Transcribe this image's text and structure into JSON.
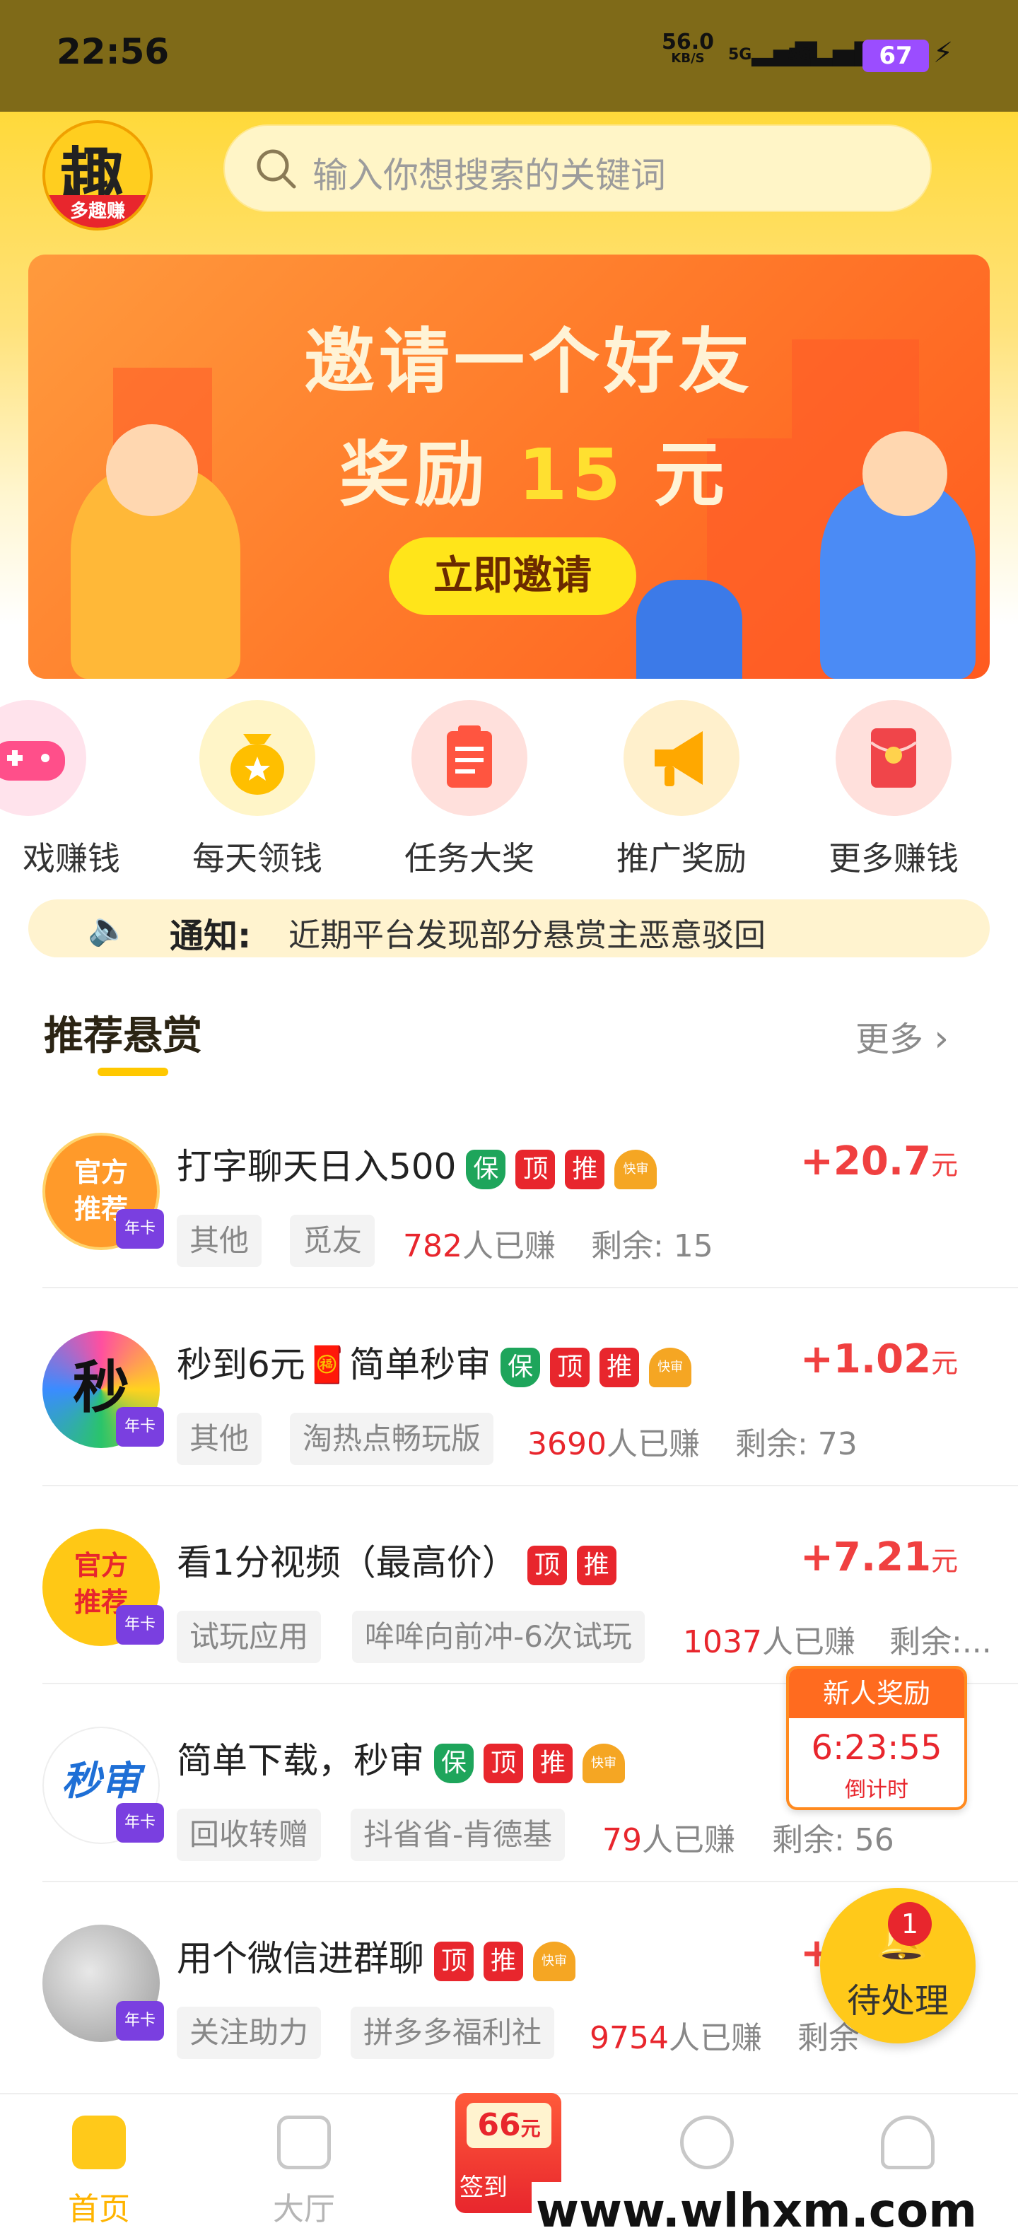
{
  "status_bar": {
    "time": "22:56",
    "net_speed": "56.0",
    "net_unit": "KB/S",
    "sig1": "5G",
    "sig2": "5G",
    "battery": "67"
  },
  "header": {
    "logo_text": "趣",
    "logo_sub": "多趣赚",
    "search_placeholder": "输入你想搜索的关键词"
  },
  "banner": {
    "line1": "邀请一个好友",
    "line2_prefix": "奖励 ",
    "line2_amount": "15",
    "line2_suffix": " 元",
    "cta": "立即邀请"
  },
  "features": [
    {
      "label": "戏赚钱",
      "icon": "gamepad-icon",
      "bg": "#ffe3ec",
      "fg": "#ff4f8a"
    },
    {
      "label": "每天领钱",
      "icon": "money-bag-icon",
      "bg": "#fff5c8",
      "fg": "#ffbf00"
    },
    {
      "label": "任务大奖",
      "icon": "clipboard-icon",
      "bg": "#ffe0dc",
      "fg": "#ff5540"
    },
    {
      "label": "推广奖励",
      "icon": "megaphone-icon",
      "bg": "#fff0cc",
      "fg": "#ffa800"
    },
    {
      "label": "更多赚钱",
      "icon": "red-packet-icon",
      "bg": "#ffe0dc",
      "fg": "#f0454a"
    }
  ],
  "notice": {
    "label": "通知:",
    "text": "近期平台发现部分悬赏主恶意驳回"
  },
  "section": {
    "title": "推荐悬赏",
    "more": "更多"
  },
  "tasks": [
    {
      "title": "打字聊天日入500",
      "avatar_text": "官方推荐",
      "crown": "年卡",
      "badges": [
        "保",
        "顶",
        "推",
        "快审"
      ],
      "price": "+20.7",
      "unit": "元",
      "tags": [
        "其他",
        "觅友"
      ],
      "earned": "782",
      "earned_suffix": "人已赚",
      "remain": "剩余: 15"
    },
    {
      "title": "秒到6元🧧简单秒审",
      "avatar_text": "秒",
      "crown": "年卡",
      "badges": [
        "保",
        "顶",
        "推",
        "快审"
      ],
      "price": "+1.02",
      "unit": "元",
      "tags": [
        "其他",
        "淘热点畅玩版"
      ],
      "earned": "3690",
      "earned_suffix": "人已赚",
      "remain": "剩余: 73"
    },
    {
      "title": "看1分视频（最高价）",
      "avatar_text": "官方推荐",
      "crown": "年卡",
      "badges": [
        "顶",
        "推"
      ],
      "price": "+7.21",
      "unit": "元",
      "tags": [
        "试玩应用",
        "哞哞向前冲-6次试玩"
      ],
      "earned": "1037",
      "earned_suffix": "人已赚",
      "remain": "剩余:..."
    },
    {
      "title": "简单下载，秒审",
      "avatar_text": "秒审",
      "crown": "年卡",
      "badges": [
        "保",
        "顶",
        "推",
        "快审"
      ],
      "price": "",
      "unit": "",
      "tags": [
        "回收转赠",
        "抖省省-肯德基"
      ],
      "earned": "79",
      "earned_suffix": "人已赚",
      "remain": "剩余: 56"
    },
    {
      "title": "用个微信进群聊",
      "avatar_text": "",
      "crown": "年卡",
      "badges": [
        "顶",
        "推",
        "快审"
      ],
      "price": "+",
      "unit": "",
      "tags": [
        "关注助力",
        "拼多多福利社"
      ],
      "earned": "9754",
      "earned_suffix": "人已赚",
      "remain": "剩余"
    }
  ],
  "newbie": {
    "title": "新人奖励",
    "time": "6:23:55",
    "label": "倒计时"
  },
  "pending": {
    "count": "1",
    "label": "待处理"
  },
  "bottom_nav": [
    {
      "label": "首页",
      "icon": "home-icon",
      "active": true
    },
    {
      "label": "大厅",
      "icon": "chart-icon",
      "active": false
    },
    {
      "label": "签到",
      "icon": "sign-in-icon",
      "amount": "66",
      "unit": "元"
    },
    {
      "label": "",
      "icon": "compass-icon",
      "active": false
    },
    {
      "label": "",
      "icon": "user-icon",
      "active": false
    }
  ],
  "watermark": "www.wlhxm.com",
  "colors": {
    "accent": "#ffc91a",
    "price": "#f04040",
    "status_bar": "#7f6a18"
  }
}
